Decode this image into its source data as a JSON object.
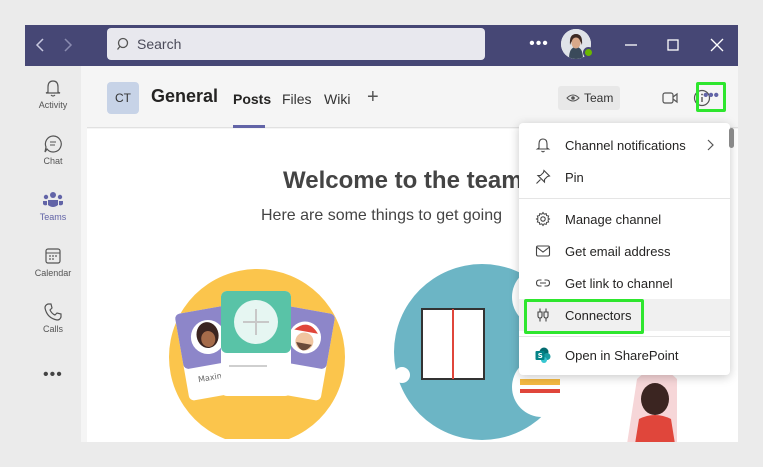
{
  "titlebar": {
    "search_placeholder": "Search",
    "more_label": "•••"
  },
  "rail": {
    "items": [
      {
        "label": "Activity"
      },
      {
        "label": "Chat"
      },
      {
        "label": "Teams"
      },
      {
        "label": "Calendar"
      },
      {
        "label": "Calls"
      }
    ],
    "more_label": "•••"
  },
  "header": {
    "team_initials": "CT",
    "channel_name": "General",
    "tabs": [
      {
        "label": "Posts"
      },
      {
        "label": "Files"
      },
      {
        "label": "Wiki"
      }
    ],
    "add_tab": "+",
    "team_button": "Team",
    "more_label": "•••"
  },
  "content": {
    "welcome_title": "Welcome to the team!",
    "welcome_subtitle": "Here are some things to get going",
    "card_names": [
      "Maxine",
      "ky"
    ]
  },
  "menu": {
    "items": [
      {
        "label": "Channel notifications",
        "icon": "bell-icon"
      },
      {
        "label": "Pin",
        "icon": "pin-icon"
      },
      {
        "label": "Manage channel",
        "icon": "gear-icon"
      },
      {
        "label": "Get email address",
        "icon": "mail-icon"
      },
      {
        "label": "Get link to channel",
        "icon": "link-icon"
      },
      {
        "label": "Connectors",
        "icon": "connectors-icon"
      },
      {
        "label": "Open in SharePoint",
        "icon": "sharepoint-icon"
      }
    ]
  },
  "colors": {
    "titlebar": "#464775",
    "accent": "#6264a7",
    "highlight": "#2ee62e"
  }
}
